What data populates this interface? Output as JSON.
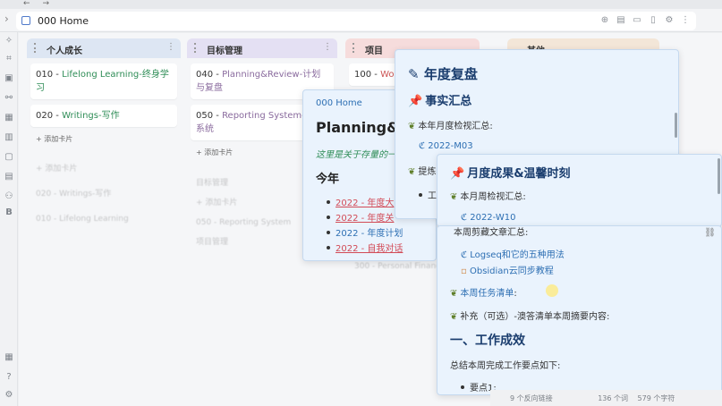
{
  "window": {
    "nav_back": "←",
    "nav_forward": "→",
    "tab_title": "000 Home",
    "tab_actions": [
      "⊕",
      "▤",
      "▭",
      "▯",
      "⚙",
      "⋮"
    ],
    "collapse": "›"
  },
  "ribbon": {
    "icons": [
      "✧",
      "⌗",
      "▣",
      "⚯",
      "▦",
      "▥",
      "▢",
      "▤",
      "⚇",
      "B",
      "▦",
      "?",
      "⚙"
    ]
  },
  "kanban": {
    "columns": [
      {
        "title": "个人成长",
        "menu": "⋮",
        "color": "#dde6f3",
        "cards": [
          {
            "num": "010 - ",
            "link": "Lifelong Learning-终身学习"
          },
          {
            "num": "020 - ",
            "link": "Writings-写作"
          }
        ],
        "add": "+ 添加卡片"
      },
      {
        "title": "目标管理",
        "menu": "⋮",
        "color": "#e4e0f3",
        "cards": [
          {
            "num": "040 - ",
            "link": "Planning&Review-计划与复盘"
          },
          {
            "num": "050 - ",
            "link": "Reporting System-报告系统"
          }
        ],
        "add": "+ 添加卡片"
      },
      {
        "title": "项目",
        "menu": "⋮",
        "color": "#f6dcdc",
        "cards": [
          {
            "num": "100 - ",
            "link": "Wo"
          }
        ],
        "add": ""
      },
      {
        "title": "其他",
        "menu": "⋮",
        "color": "#f3e6d8",
        "cards": [],
        "add": ""
      }
    ],
    "faded_texts": [
      "+ 添加卡片",
      "020 - Writings-写作",
      "010 - Lifelong Learning",
      "目标管理",
      "+ 添加卡片",
      "050 - Reporting System",
      "项目管理",
      "300 - Personal Finance"
    ]
  },
  "pop_home": {
    "breadcrumb": "000 Home",
    "title": "Planning&R",
    "subtitle": "这里是关于存量的一",
    "section": "今年",
    "items": [
      "2022 - 年度大",
      "2022 - 年度关",
      "2022 - 年度计划",
      "2022 - 自我对话"
    ]
  },
  "pop_year": {
    "title": "年度复盘",
    "h_facts": "事实汇总",
    "row1": "本年月度检视汇总:",
    "link1": "2022-M03",
    "row2": "提炼",
    "row3": "工"
  },
  "pop_month": {
    "title": "月度成果&温馨时刻",
    "row1": "本月周检视汇总:",
    "link1": "2022-W10"
  },
  "pop_week": {
    "row0": "本周剪藏文章汇总:",
    "links": [
      "Logseq和它的五种用法",
      "Obsidian云同步教程"
    ],
    "task_link": "本周任务清单",
    "task_colon": ":",
    "row_sup": "补充（可选）-澳答清单本周摘要内容:",
    "h_work": "一、工作成效",
    "row_sum": "总结本周完成工作要点如下:",
    "point": "要点1:"
  },
  "status": {
    "backlinks": "9 个反向链接",
    "words": "136 个词",
    "chars": "579 个字符"
  }
}
